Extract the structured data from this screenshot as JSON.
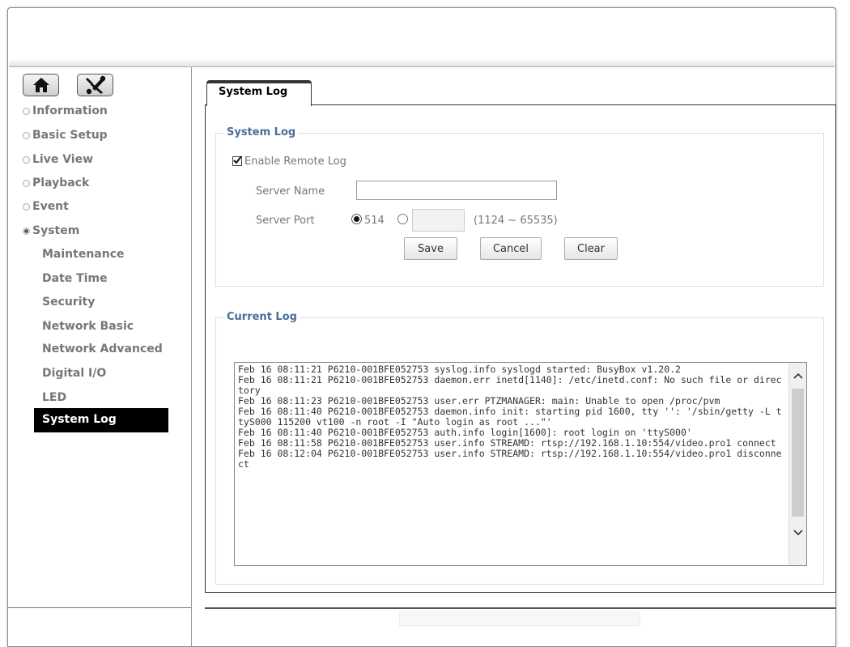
{
  "sidebar": {
    "nav": [
      {
        "label": "Information",
        "selected": false
      },
      {
        "label": "Basic Setup",
        "selected": false
      },
      {
        "label": "Live View",
        "selected": false
      },
      {
        "label": "Playback",
        "selected": false
      },
      {
        "label": "Event",
        "selected": false
      },
      {
        "label": "System",
        "selected": true
      }
    ],
    "system_items": [
      "Maintenance",
      "Date Time",
      "Security",
      "Network Basic",
      "Network Advanced",
      "Digital I/O",
      "LED",
      "System Log"
    ],
    "active_item": "System Log"
  },
  "tab": {
    "label": "System Log"
  },
  "system_log": {
    "legend": "System Log",
    "enable_remote_log_label": "Enable Remote Log",
    "enable_remote_log_checked": true,
    "server_name_label": "Server Name",
    "server_name_value": "",
    "server_port_label": "Server Port",
    "port_option_default": "514",
    "port_default_selected": true,
    "custom_port_value": "",
    "port_range_hint": "(1124 ~ 65535)",
    "buttons": {
      "save": "Save",
      "cancel": "Cancel",
      "clear": "Clear"
    }
  },
  "current_log": {
    "legend": "Current Log",
    "text": "Feb 16 08:11:21 P6210-001BFE052753 syslog.info syslogd started: BusyBox v1.20.2\nFeb 16 08:11:21 P6210-001BFE052753 daemon.err inetd[1140]: /etc/inetd.conf: No such file or directory\nFeb 16 08:11:23 P6210-001BFE052753 user.err PTZMANAGER: main: Unable to open /proc/pvm\nFeb 16 08:11:40 P6210-001BFE052753 daemon.info init: starting pid 1600, tty '': '/sbin/getty -L ttyS000 115200 vt100 -n root -I \"Auto login as root ...\"'\nFeb 16 08:11:40 P6210-001BFE052753 auth.info login[1600]: root login on 'ttyS000'\nFeb 16 08:11:58 P6210-001BFE052753 user.info STREAMD: rtsp://192.168.1.10:554/video.pro1 connect\nFeb 16 08:12:04 P6210-001BFE052753 user.info STREAMD: rtsp://192.168.1.10:554/video.pro1 disconnect"
  }
}
